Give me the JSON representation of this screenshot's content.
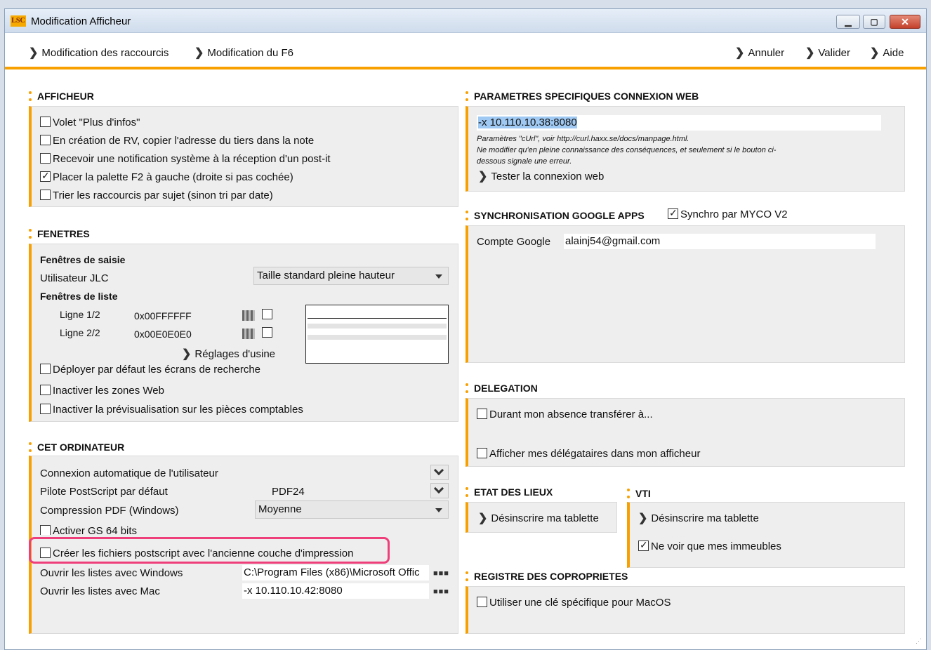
{
  "window": {
    "title": "Modification Afficheur",
    "logo": "LSC"
  },
  "nav": {
    "left": [
      "Modification des raccourcis",
      "Modification du F6"
    ],
    "right": [
      "Annuler",
      "Valider",
      "Aide"
    ]
  },
  "afficheur": {
    "title": "AFFICHEUR",
    "items": [
      {
        "label": "Volet \"Plus d'infos\"",
        "checked": false
      },
      {
        "label": "En création de RV, copier l'adresse du tiers dans la note",
        "checked": false
      },
      {
        "label": "Recevoir une notification système à la réception d'un post-it",
        "checked": false
      },
      {
        "label": "Placer la palette F2 à gauche (droite si pas cochée)",
        "checked": true
      },
      {
        "label": "Trier les raccourcis par sujet (sinon tri par date)",
        "checked": false
      }
    ]
  },
  "fenetres": {
    "title": "FENETRES",
    "saisie_title": "Fenêtres de saisie",
    "utilisateur_label": "Utilisateur JLC",
    "utilisateur_value": "Taille standard pleine hauteur",
    "liste_title": "Fenêtres de liste",
    "ligne1_label": "Ligne 1/2",
    "ligne1_value": "0x00FFFFFF",
    "ligne2_label": "Ligne 2/2",
    "ligne2_value": "0x00E0E0E0",
    "reglages": "Réglages d'usine",
    "items": [
      {
        "label": "Déployer par défaut les écrans de recherche",
        "checked": false
      },
      {
        "label": "Inactiver les zones Web",
        "checked": false
      },
      {
        "label": "Inactiver la prévisualisation sur les pièces comptables",
        "checked": false
      }
    ]
  },
  "ordinateur": {
    "title": "CET ORDINATEUR",
    "connexion_label": "Connexion automatique de l'utilisateur",
    "pilote_label": "Pilote PostScript par défaut",
    "pilote_value": "PDF24",
    "compression_label": "Compression PDF (Windows)",
    "compression_value": "Moyenne",
    "gs64_label": "Activer GS 64 bits",
    "postscript_label": "Créer les fichiers postscript avec l'ancienne couche d'impression",
    "windows_label": "Ouvrir les listes avec Windows",
    "windows_value": "C:\\Program Files (x86)\\Microsoft Offic",
    "mac_label": "Ouvrir les listes avec Mac",
    "mac_value": "-x 10.110.10.42:8080",
    "dots": "■■■"
  },
  "web": {
    "title": "PARAMETRES SPECIFIQUES CONNEXION WEB",
    "value": "-x 10.110.10.38:8080",
    "note1": "Paramètres \"cUrl\", voir http://curl.haxx.se/docs/manpage.html.",
    "note2": "Ne modifier qu'en pleine connaissance des conséquences, et seulement si le bouton ci-",
    "note3": "dessous signale une erreur.",
    "tester": "Tester la connexion web"
  },
  "google": {
    "title": "SYNCHRONISATION GOOGLE APPS",
    "synchro_label": "Synchro par MYCO V2",
    "compte_label": "Compte Google",
    "compte_value": "alainj54@gmail.com"
  },
  "delegation": {
    "title": "DELEGATION",
    "item1": "Durant mon absence transférer à...",
    "item2": "Afficher mes délégataires dans mon afficheur"
  },
  "etat": {
    "title": "ETAT DES LIEUX",
    "button": "Désinscrire ma tablette"
  },
  "vti": {
    "title": "VTI",
    "button": "Désinscrire ma tablette",
    "immeubles": "Ne voir que mes immeubles"
  },
  "registre": {
    "title": "REGISTRE DES COPROPRIETES",
    "item": "Utiliser une clé spécifique pour MacOS"
  },
  "colors": {
    "accent": "#f7a000",
    "highlight": "#ef3f7a",
    "panel": "#eeeeee"
  }
}
